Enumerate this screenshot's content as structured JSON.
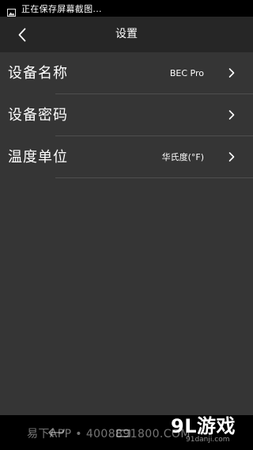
{
  "status_bar": {
    "notification_text": "正在保存屏幕截图..."
  },
  "header": {
    "title": "设置"
  },
  "settings": [
    {
      "label": "设备名称",
      "value": "BEC Pro"
    },
    {
      "label": "设备密码",
      "value": ""
    },
    {
      "label": "温度单位",
      "value": "华氏度(°F)"
    }
  ],
  "watermark": {
    "text": "易下APP • 4008891800.COM",
    "logo": "9L游戏",
    "site": "91danji.com"
  },
  "colors": {
    "background": "#353535",
    "header": "#262626",
    "status_bar": "#000000",
    "divider": "#4e4e4e",
    "text": "#ffffff"
  },
  "icons": {
    "status": "screenshot-icon",
    "back": "back-icon",
    "chevron": "chevron-right-icon"
  }
}
